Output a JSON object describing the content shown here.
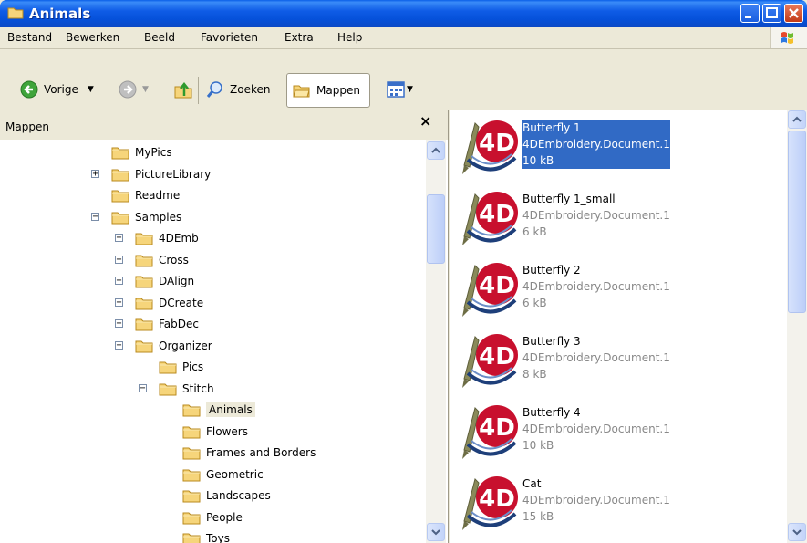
{
  "window": {
    "title": "Animals"
  },
  "menu": [
    "Bestand",
    "Bewerken",
    "Beeld",
    "Favorieten",
    "Extra",
    "Help"
  ],
  "toolbar": {
    "back": "Vorige",
    "search": "Zoeken",
    "folders": "Mappen"
  },
  "folders_pane": {
    "title": "Mappen",
    "close": "×",
    "items": [
      {
        "label": "MyPics",
        "expander": ""
      },
      {
        "label": "PictureLibrary",
        "expander": "+"
      },
      {
        "label": "Readme",
        "expander": ""
      },
      {
        "label": "Samples",
        "expander": "−"
      },
      {
        "label": "4DEmb",
        "expander": "+"
      },
      {
        "label": "Cross",
        "expander": "+"
      },
      {
        "label": "DAlign",
        "expander": "+"
      },
      {
        "label": "DCreate",
        "expander": "+"
      },
      {
        "label": "FabDec",
        "expander": "+"
      },
      {
        "label": "Organizer",
        "expander": "−"
      },
      {
        "label": "Pics",
        "expander": ""
      },
      {
        "label": "Stitch",
        "expander": "−"
      },
      {
        "label": "Animals",
        "expander": "",
        "selected": true
      },
      {
        "label": "Flowers",
        "expander": ""
      },
      {
        "label": "Frames and Borders",
        "expander": ""
      },
      {
        "label": "Geometric",
        "expander": ""
      },
      {
        "label": "Landscapes",
        "expander": ""
      },
      {
        "label": "People",
        "expander": ""
      },
      {
        "label": "Toys",
        "expander": ""
      }
    ]
  },
  "files": [
    {
      "name": "Butterfly 1",
      "type": "4DEmbroidery.Document.1",
      "size": "10 kB",
      "selected": true
    },
    {
      "name": "Butterfly 1_small",
      "type": "4DEmbroidery.Document.1",
      "size": "6 kB"
    },
    {
      "name": "Butterfly 2",
      "type": "4DEmbroidery.Document.1",
      "size": "6 kB"
    },
    {
      "name": "Butterfly 3",
      "type": "4DEmbroidery.Document.1",
      "size": "8 kB"
    },
    {
      "name": "Butterfly 4",
      "type": "4DEmbroidery.Document.1",
      "size": "10 kB"
    },
    {
      "name": "Cat",
      "type": "4DEmbroidery.Document.1",
      "size": "15 kB"
    }
  ],
  "icons": {
    "folder": "folder-icon",
    "back": "back-arrow-icon",
    "forward": "forward-arrow-icon",
    "up": "up-folder-icon",
    "search": "search-icon",
    "folders": "folders-icon",
    "views": "views-icon",
    "file": "4d-embroidery-icon"
  },
  "colors": {
    "titlebar": "#0A5FE8",
    "selection": "#316AC5",
    "folder": "#F6D57B"
  }
}
